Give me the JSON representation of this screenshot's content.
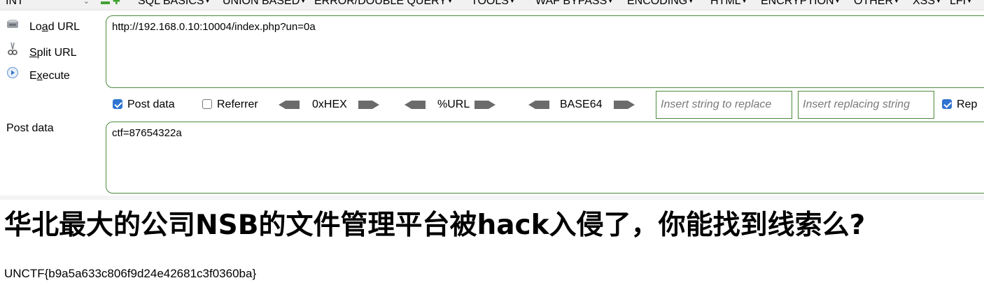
{
  "toolbar": {
    "injection_type": "INT",
    "menus": [
      "SQL BASICS",
      "UNION BASED",
      "ERROR/DOUBLE QUERY",
      "TOOLS",
      "WAF BYPASS",
      "ENCODING",
      "HTML",
      "ENCRYPTION",
      "OTHER",
      "XSS",
      "LFI"
    ]
  },
  "sidebar": {
    "load_url": {
      "pre": "Lo",
      "key": "a",
      "post": "d URL"
    },
    "split_url": {
      "pre": "",
      "key": "S",
      "post": "plit URL"
    },
    "execute": {
      "pre": "E",
      "key": "x",
      "post": "ecute"
    }
  },
  "url_box": {
    "value": "http://192.168.0.10:10004/index.php?un=0a"
  },
  "options": {
    "post_data_label": "Post data",
    "post_data_checked": true,
    "referrer_label": "Referrer",
    "referrer_checked": false,
    "hex_label": "0xHEX",
    "url_label": "%URL",
    "base64_label": "BASE64",
    "insert_find_placeholder": "Insert string to replace",
    "insert_replace_placeholder": "Insert replacing string",
    "replace_all_label": "Rep",
    "replace_all_checked": true
  },
  "post_section": {
    "label": "Post data",
    "value": "ctf=87654322a"
  },
  "page": {
    "heading": "华北最大的公司NSB的文件管理平台被hack入侵了，你能找到线索么?",
    "flag": "UNCTF{b9a5a633c806f9d24e42681c3f0360ba}"
  },
  "colors": {
    "accent_green": "#4b8a3c",
    "checkbox_blue": "#2f74d0"
  }
}
